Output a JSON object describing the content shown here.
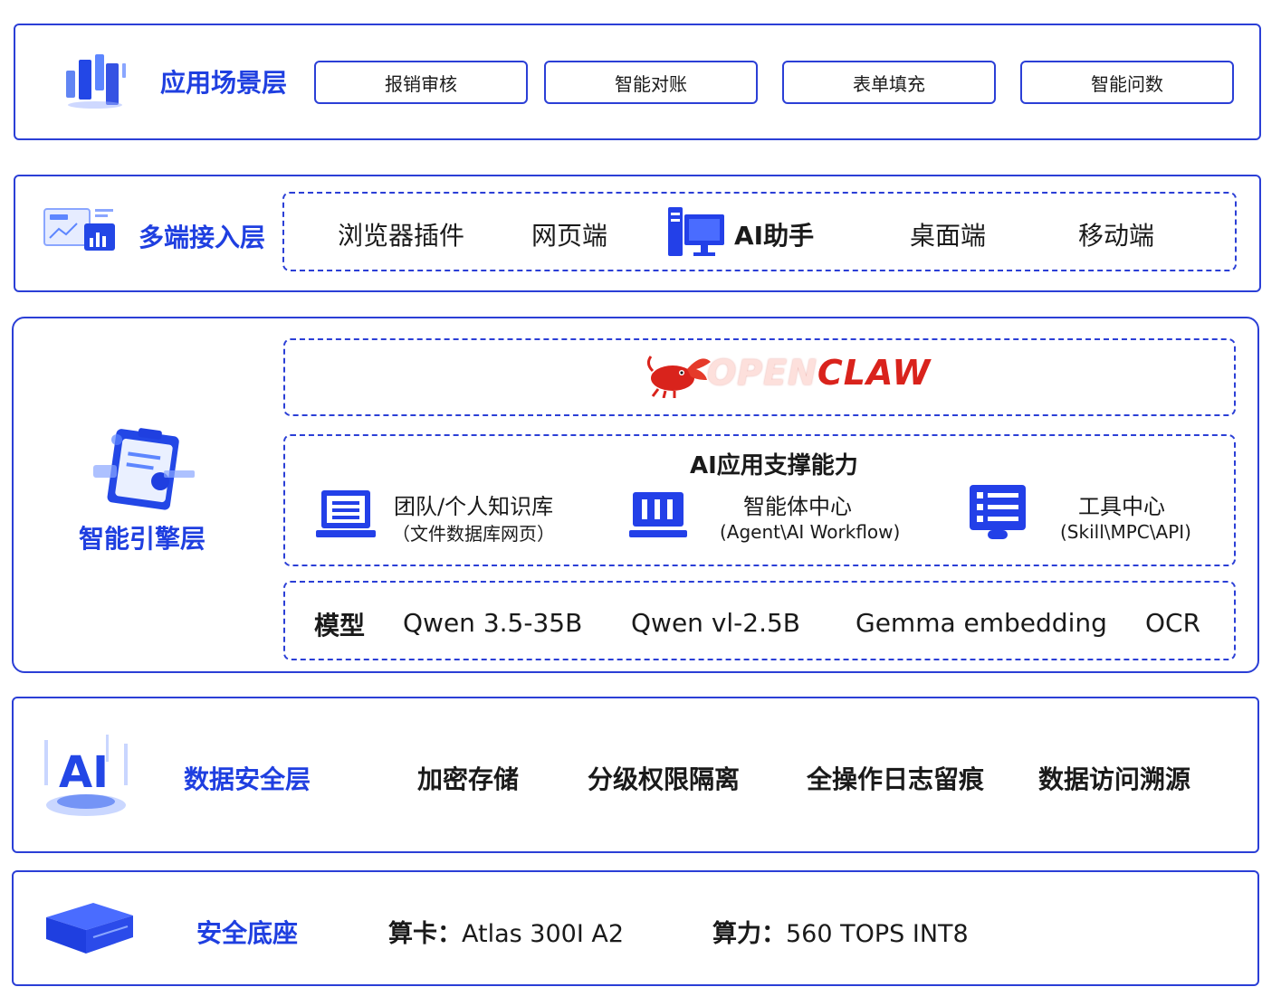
{
  "application_layer": {
    "title": "应用场景层",
    "items": [
      "报销审核",
      "智能对账",
      "表单填充",
      "智能问数"
    ]
  },
  "access_layer": {
    "title": "多端接入层",
    "items": [
      "浏览器插件",
      "网页端",
      "AI助手",
      "桌面端",
      "移动端"
    ]
  },
  "engine_layer": {
    "title": "智能引擎层",
    "brand_logo": {
      "left": "OPEN",
      "right": "CLAW"
    },
    "capability_title": "AI应用支撑能力",
    "capabilities": [
      {
        "name": "团队/个人知识库",
        "detail": "（文件数据库网页）",
        "icon": "laptop-icon"
      },
      {
        "name": "智能体中心",
        "detail": "(Agent\\AI Workflow)",
        "icon": "bar-chart-icon"
      },
      {
        "name": "工具中心",
        "detail": "(Skill\\MPC\\API)",
        "icon": "server-list-icon"
      }
    ],
    "model_label": "模型",
    "models": [
      "Qwen 3.5-35B",
      "Qwen vl-2.5B",
      "Gemma embedding",
      "OCR"
    ]
  },
  "security_layer": {
    "title": "数据安全层",
    "icon_text": "AI",
    "items": [
      "加密存储",
      "分级权限隔离",
      "全操作日志留痕",
      "数据访问溯源"
    ]
  },
  "base_layer": {
    "title": "安全底座",
    "card_label": "算卡：",
    "card_value": "Atlas 300I A2",
    "compute_label": "算力：",
    "compute_value": "560 TOPS INT8"
  },
  "colors": {
    "primary": "#2b3fd6",
    "title_blue": "#1f3fe0",
    "icon_blue": "#2340e8",
    "claw_red": "#d9231c"
  }
}
